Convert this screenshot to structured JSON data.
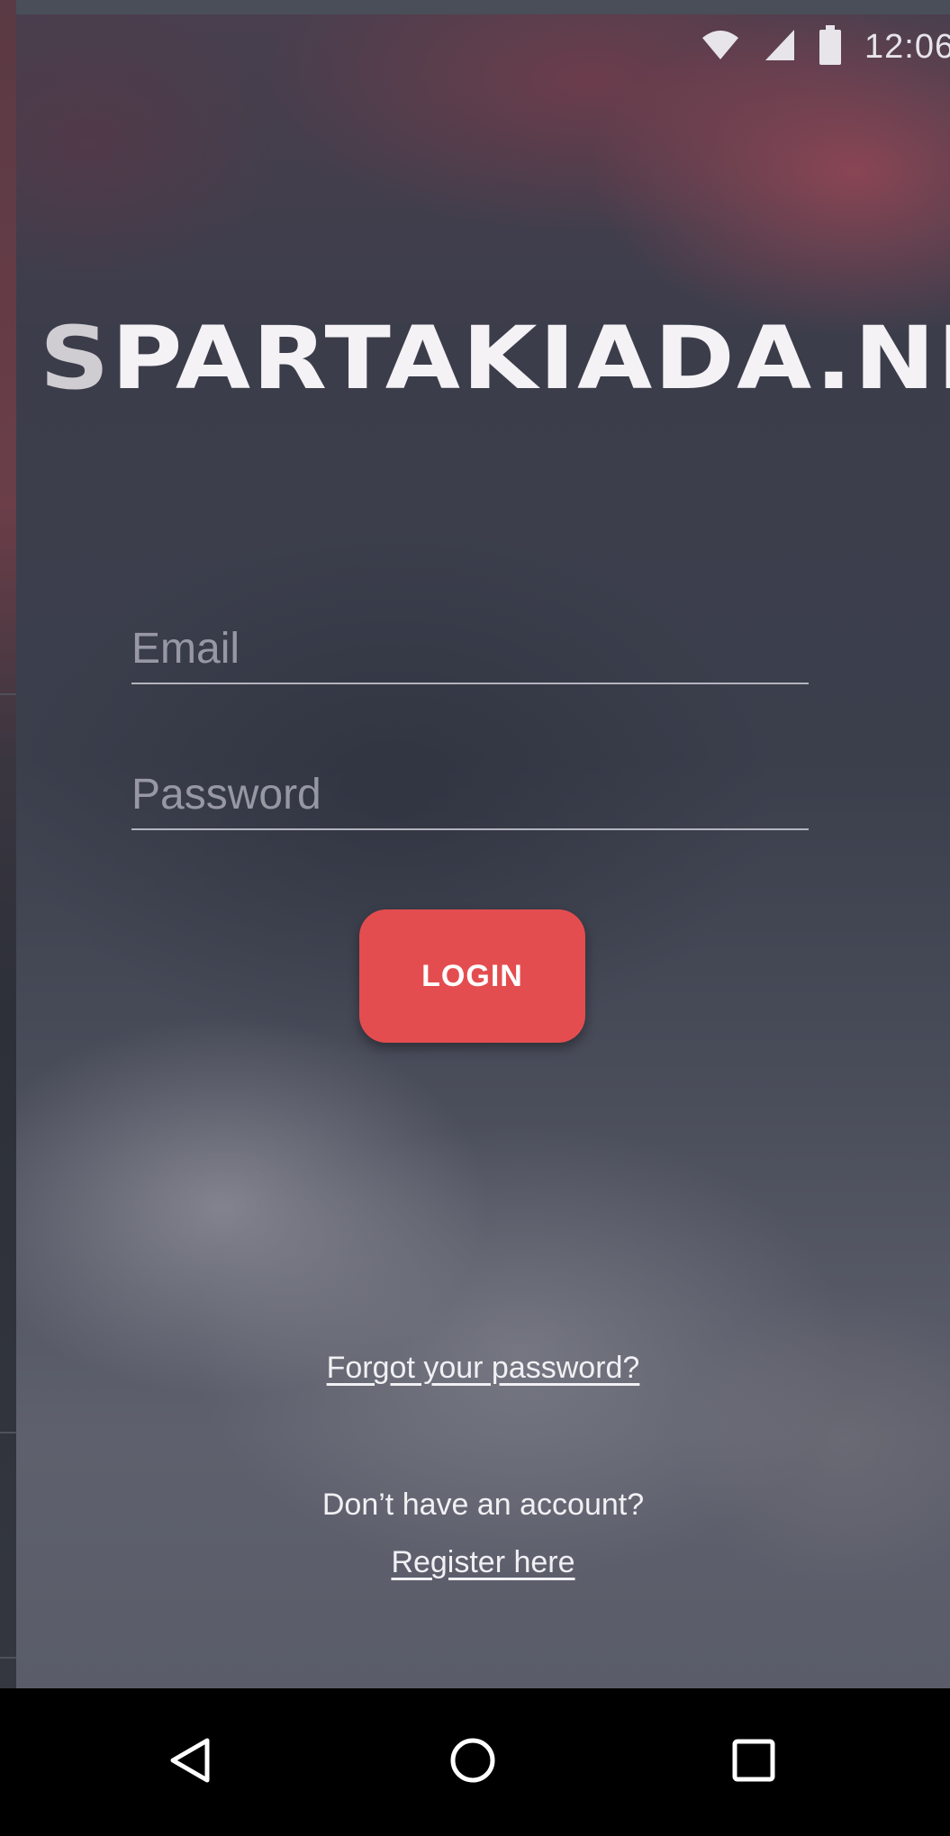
{
  "status_bar": {
    "time": "12:06",
    "icons": [
      "wifi-icon",
      "signal-icon",
      "battery-icon"
    ]
  },
  "logo": {
    "text": "SPARTAKIADA.NET"
  },
  "form": {
    "email_placeholder": "Email",
    "password_placeholder": "Password",
    "login_label": "LOGIN"
  },
  "links": {
    "forgot_password": "Forgot your password?",
    "no_account": "Don’t have an account?",
    "register": "Register here"
  },
  "nav_bar": {
    "icons": [
      "back-icon",
      "home-icon",
      "recents-icon"
    ]
  },
  "colors": {
    "accent": "#e44d4f",
    "nav_bar": "#000000"
  }
}
